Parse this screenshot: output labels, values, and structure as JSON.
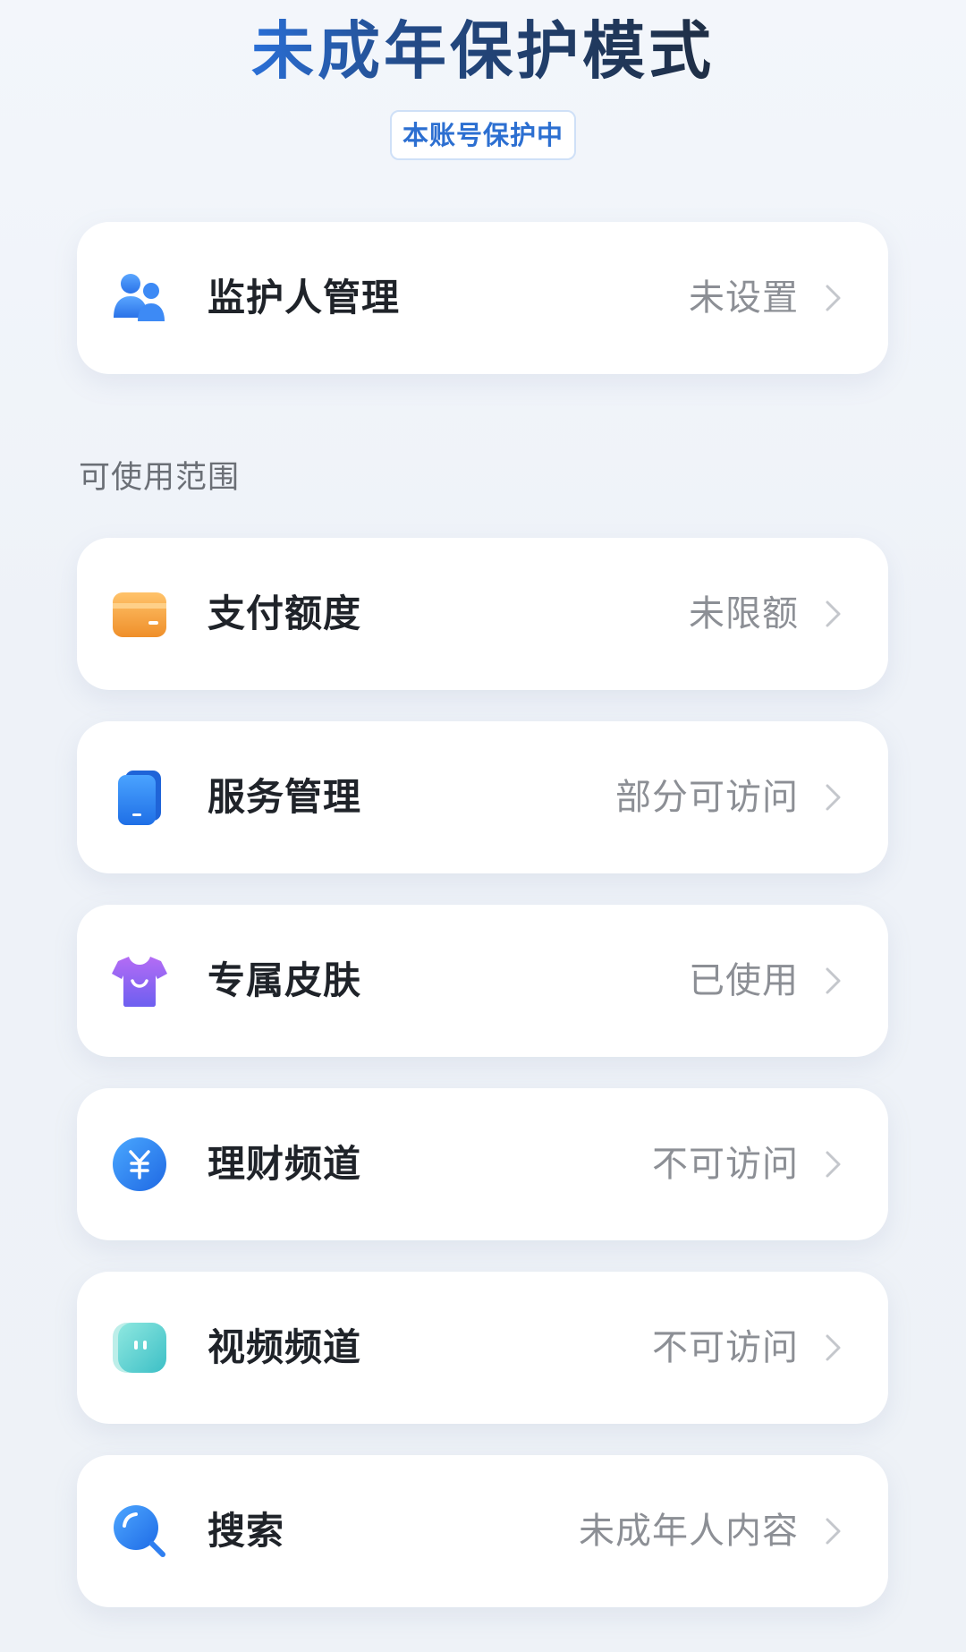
{
  "header": {
    "title": "未成年保护模式",
    "status_badge": "本账号保护中"
  },
  "guardian": {
    "label": "监护人管理",
    "value": "未设置",
    "icon": "guardian-people-icon"
  },
  "section": {
    "label": "可使用范围"
  },
  "items": [
    {
      "label": "支付额度",
      "value": "未限额",
      "icon": "wallet-icon",
      "color": "#f2a23c"
    },
    {
      "label": "服务管理",
      "value": "部分可访问",
      "icon": "phone-apps-icon",
      "color": "#2b86f0"
    },
    {
      "label": "专属皮肤",
      "value": "已使用",
      "icon": "tshirt-icon",
      "color": "#8a5cf0"
    },
    {
      "label": "理财频道",
      "value": "不可访问",
      "icon": "yuan-coin-icon",
      "color": "#2a7ff0"
    },
    {
      "label": "视频频道",
      "value": "不可访问",
      "icon": "video-face-icon",
      "color": "#43c7c4"
    },
    {
      "label": "搜索",
      "value": "未成年人内容",
      "icon": "search-icon",
      "color": "#2b7ef2"
    }
  ]
}
